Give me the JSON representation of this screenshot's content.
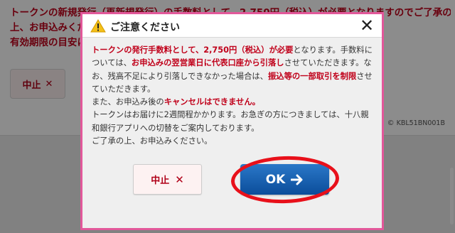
{
  "background": {
    "notice_lines": [
      "トークンの新規発行（再新規発行）の手数料として、2,750円（税込）が必要となりますのでご了承の",
      "上、お申込みください。",
      "有効期限の目安につきましては、"
    ],
    "cancel_label": "中止",
    "cancel_icon": "✕",
    "screen_code": "KBL51BN001B",
    "screen_code_icon": "©"
  },
  "modal": {
    "title": "ご注意ください",
    "close_icon": "✕",
    "warning_icon": "warning-triangle-icon",
    "body": {
      "p1_a": "トークンの発行手数料として、2,750円（税込）が必要",
      "p1_b": "となります。手数料については、",
      "p1_c": "お申込みの翌営業日に代表口座から引落し",
      "p1_d": "させていただきます。なお、残高不足により引落しできなかった場合は、",
      "p1_e": "振込等の一部取引を制限",
      "p1_f": "させていただきます。",
      "p2_a": "また、お申込み後の",
      "p2_b": "キャンセルはできません。",
      "p3": "トークンはお届けに2週間程かかります。お急ぎの方につきましては、十八親和銀行アプリへの切替をご案内しております。",
      "p4": "ご了承の上、お申込みください。"
    },
    "cancel_label": "中止",
    "cancel_icon": "✕",
    "ok_label": "OK"
  },
  "colors": {
    "accent_red": "#c0001a",
    "modal_border": "#e2589a",
    "ok_blue": "#0b4d9a",
    "highlight": "#e8101a"
  }
}
